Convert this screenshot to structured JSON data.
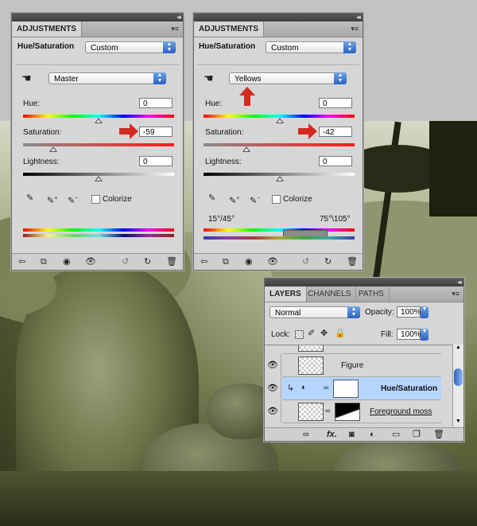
{
  "adjustments_left": {
    "tab": "ADJUSTMENTS",
    "title": "Hue/Saturation",
    "preset": "Custom",
    "channel": "Master",
    "hue_label": "Hue:",
    "hue_value": "0",
    "saturation_label": "Saturation:",
    "saturation_value": "-59",
    "lightness_label": "Lightness:",
    "lightness_value": "0",
    "colorize_label": "Colorize",
    "hue_level": 0.5,
    "saturation_level": 0.2,
    "lightness_level": 0.5
  },
  "adjustments_right": {
    "tab": "ADJUSTMENTS",
    "title": "Hue/Saturation",
    "preset": "Custom",
    "channel": "Yellows",
    "hue_label": "Hue:",
    "hue_value": "0",
    "saturation_label": "Saturation:",
    "saturation_value": "-42",
    "lightness_label": "Lightness:",
    "lightness_value": "0",
    "colorize_label": "Colorize",
    "range_left": "15°/45°",
    "range_right": "75°\\105°"
  },
  "layers": {
    "tabs": [
      "LAYERS",
      "CHANNELS",
      "PATHS"
    ],
    "blend_mode": "Normal",
    "opacity_label": "Opacity:",
    "opacity_value": "100%",
    "lock_label": "Lock:",
    "fill_label": "Fill:",
    "fill_value": "100%",
    "rows": [
      {
        "name": "Figure"
      },
      {
        "name": "Hue/Saturation"
      },
      {
        "name": "Foreground moss"
      }
    ]
  },
  "colors": {
    "accent_arrow": "#d42a1f",
    "selected_row": "#b5d5ff",
    "select_blue": "#2a62c4"
  },
  "icons": [
    "hand-adjust-icon",
    "eyedropper-icon",
    "eyedropper-plus-icon",
    "eyedropper-minus-icon",
    "back-arrow-icon",
    "clip-icon",
    "visibility-icon",
    "eye-icon",
    "reset-icon",
    "refresh-icon",
    "trash-icon",
    "link-icon",
    "fx-icon",
    "mask-icon",
    "adjustment-icon",
    "folder-icon",
    "new-layer-icon",
    "lock-transparent-icon",
    "brush-icon",
    "move-icon",
    "lock-icon"
  ]
}
